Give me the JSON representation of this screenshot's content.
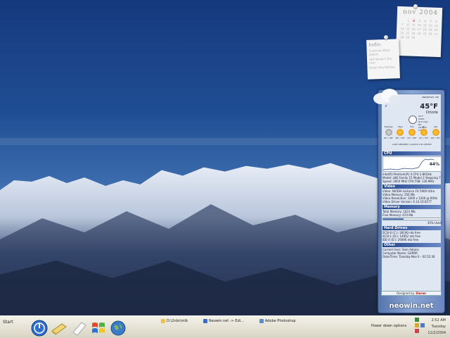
{
  "calendar": {
    "month": "nov",
    "year": "2004",
    "days": [
      "",
      "1",
      "2",
      "3",
      "4",
      "5",
      "6",
      "7",
      "8",
      "9",
      "10",
      "11",
      "12",
      "13",
      "14",
      "15",
      "16",
      "17",
      "18",
      "19",
      "20",
      "21",
      "22",
      "23",
      "24",
      "25",
      "26",
      "27",
      "28",
      "29",
      "30"
    ],
    "today": "2"
  },
  "todo": {
    "title": "todo:",
    "items": [
      "Continue FMLA papers",
      "Get Vance 1 tire rack",
      "Email Amy Denise"
    ]
  },
  "weather": {
    "location": "ANNAPOLIS, MD",
    "temperature": "45°F",
    "condition": "Drizzle",
    "stats": [
      "31°F",
      "100%",
      "W 9 mph",
      "NA",
      "29.98 in",
      "0.5 mi"
    ],
    "forecast": [
      {
        "day": "Tuesday",
        "temps": "45° / 46°",
        "icon": "cloudy"
      },
      {
        "day": "Wed",
        "temps": "48° / 55°",
        "icon": "sun"
      },
      {
        "day": "Thu",
        "temps": "47° / 58°",
        "icon": "sun"
      },
      {
        "day": "Fri",
        "temps": "41° / 53°",
        "icon": "sun"
      },
      {
        "day": "Sat",
        "temps": "40° / 55°",
        "icon": "sun"
      }
    ],
    "last_updated": "LAST UPDATED: 11/2/04 2:45 AM EST"
  },
  "sections": {
    "cpu_header": "CPU",
    "cpu_percent": "44%",
    "cpu_lines": [
      "Intel(R) Pentium(R) 4 CPU 2.80GHz",
      "Model: x86 Family 15 Model 2 Stepping 7",
      "Speed: 2854 MHz      CPU FSB: 136 MHz"
    ],
    "video_header": "Video",
    "video_lines": [
      "Video: NVIDIA GeForce FX 5900 Ultra",
      "Video Memory: 256 Mb",
      "Video Resolution: 1600 x 1200 @ 60Hz",
      "Video Driver Version: 6.14.10.6177"
    ],
    "memory_header": "Memory",
    "memory_lines": [
      "Total Memory: 1023 Mb",
      "Free Memory: 670 Mb"
    ],
    "memory_used": "35% Used",
    "memory_used_fraction": 0.35,
    "drives_header": "Hard Drives",
    "drives_lines": [
      "SCSI-0 (C:): 28190 mb free",
      "SCSI-1 (D:): 14952 mb free",
      "IDE-0 (E:): 29496 mb free"
    ],
    "other_header": "Other",
    "other_lines": [
      "Current User: Sam Adams",
      "Computer Name: GURRR",
      "Date/Time: Tuesday-Nov-2 - 02:52:36"
    ],
    "designed_by": "Designed by:",
    "designer": "Siaran",
    "brand": "neowin.net"
  },
  "taskbar": {
    "start_label": "Start",
    "apps": [
      {
        "label": "D:\\2nbr\\mlb",
        "icon": "folder-icon"
      },
      {
        "label": "Neowin.net -> Edi...",
        "icon": "browser-icon"
      },
      {
        "label": "Adobe Photoshop",
        "icon": "photoshop-icon"
      }
    ],
    "power_label": "Power down options",
    "time": "2:52 AM",
    "day": "Tuesday",
    "date": "11/2/2004"
  },
  "colors": {
    "sky_top": "#16397d",
    "sidebar_header": "#24468c",
    "taskbar": "#e8e6da"
  }
}
